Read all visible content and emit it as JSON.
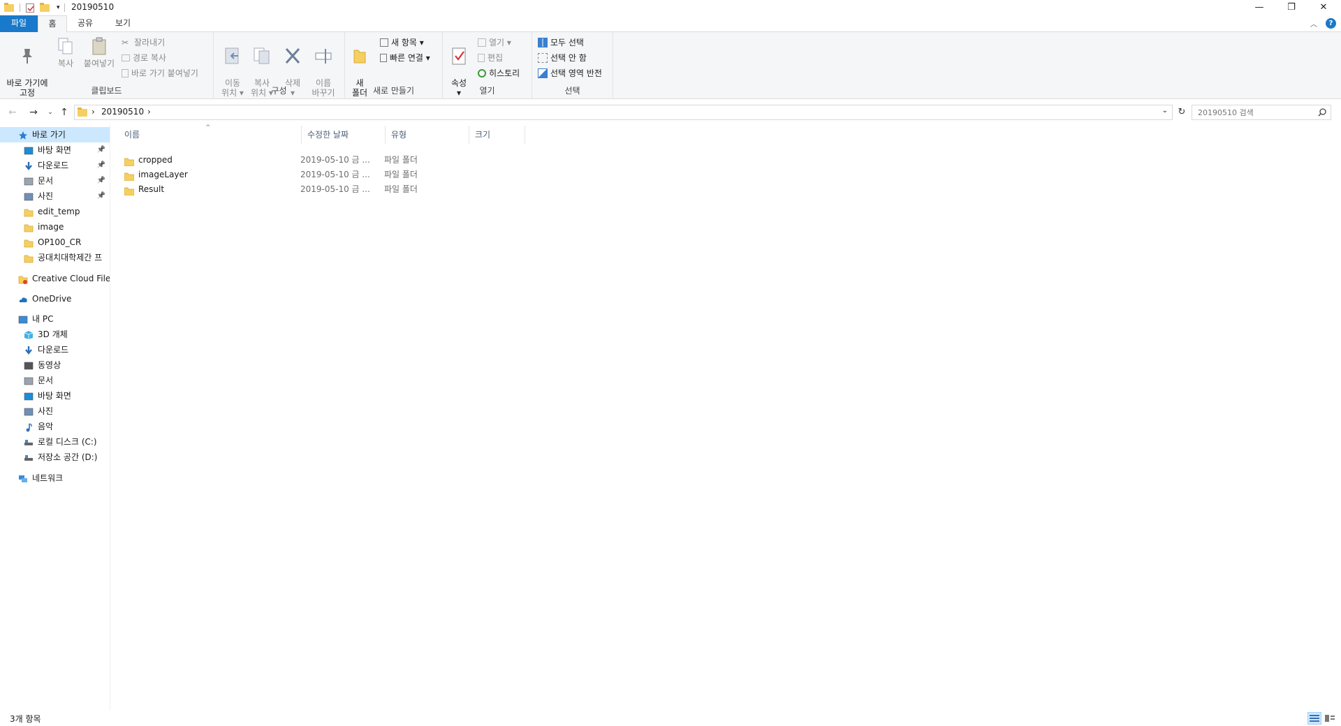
{
  "window": {
    "title": "20190510",
    "controls": {
      "minimize": "—",
      "restore": "❐",
      "close": "✕"
    }
  },
  "tabs": [
    {
      "label": "파일"
    },
    {
      "label": "홈"
    },
    {
      "label": "공유"
    },
    {
      "label": "보기"
    }
  ],
  "ribbon": {
    "clipboard": {
      "label": "클립보드",
      "pin": "바로 가기에\n고정",
      "copy": "복사",
      "paste": "붙여넣기",
      "cut": "잘라내기",
      "copy_path": "경로 복사",
      "paste_shortcut": "바로 가기 붙여넣기"
    },
    "organize": {
      "label": "구성",
      "move_to": "이동\n위치 ▾",
      "copy_to": "복사\n위치 ▾",
      "delete": "삭제\n▾",
      "rename": "이름\n바꾸기"
    },
    "new": {
      "label": "새로 만들기",
      "new_folder": "새\n폴더",
      "new_item": "새 항목 ▾",
      "easy_access": "빠른 연결 ▾"
    },
    "open": {
      "label": "열기",
      "properties": "속성\n▾",
      "open": "열기 ▾",
      "edit": "편집",
      "history": "히스토리"
    },
    "select": {
      "label": "선택",
      "select_all": "모두 선택",
      "select_none": "선택 안 함",
      "invert": "선택 영역 반전"
    }
  },
  "address": {
    "path": [
      "20190510"
    ],
    "sep": "›",
    "search_placeholder": "20190510 검색"
  },
  "nav": [
    {
      "label": "바로 가기",
      "icon": "star-icon",
      "pinned": false
    },
    {
      "label": "바탕 화면",
      "icon": "desktop-icon",
      "pinned": true
    },
    {
      "label": "다운로드",
      "icon": "download-icon",
      "pinned": true
    },
    {
      "label": "문서",
      "icon": "document-icon",
      "pinned": true
    },
    {
      "label": "사진",
      "icon": "picture-icon",
      "pinned": true
    },
    {
      "label": "edit_temp",
      "icon": "folder-icon",
      "pinned": false
    },
    {
      "label": "image",
      "icon": "folder-icon",
      "pinned": false
    },
    {
      "label": "OP100_CR",
      "icon": "folder-icon",
      "pinned": false
    },
    {
      "label": "공대치대학제간 프",
      "icon": "folder-icon",
      "pinned": false
    },
    {
      "label": "Creative Cloud Files",
      "icon": "creative-cloud-icon",
      "pinned": false
    },
    {
      "label": "OneDrive",
      "icon": "onedrive-icon",
      "pinned": false
    },
    {
      "label": "내 PC",
      "icon": "pc-icon",
      "pinned": false
    },
    {
      "label": "3D 개체",
      "icon": "cube-icon",
      "pinned": false
    },
    {
      "label": "다운로드",
      "icon": "download-icon",
      "pinned": false
    },
    {
      "label": "동영상",
      "icon": "video-icon",
      "pinned": false
    },
    {
      "label": "문서",
      "icon": "document-icon",
      "pinned": false
    },
    {
      "label": "바탕 화면",
      "icon": "desktop-icon",
      "pinned": false
    },
    {
      "label": "사진",
      "icon": "picture-icon",
      "pinned": false
    },
    {
      "label": "음악",
      "icon": "music-icon",
      "pinned": false
    },
    {
      "label": "로컬 디스크 (C:)",
      "icon": "drive-icon",
      "pinned": false
    },
    {
      "label": "저장소 공간 (D:)",
      "icon": "drive-icon",
      "pinned": false
    },
    {
      "label": "네트워크",
      "icon": "network-icon",
      "pinned": false
    }
  ],
  "columns": {
    "name": "이름",
    "modified": "수정한 날짜",
    "type": "유형",
    "size": "크기"
  },
  "files": [
    {
      "name": "cropped",
      "modified": "2019-05-10 금 ...",
      "type": "파일 폴더"
    },
    {
      "name": "imageLayer",
      "modified": "2019-05-10 금 ...",
      "type": "파일 폴더"
    },
    {
      "name": "Result",
      "modified": "2019-05-10 금 ...",
      "type": "파일 폴더"
    }
  ],
  "status": {
    "count": "3개 항목"
  },
  "colors": {
    "accent": "#1979ca",
    "selection": "#cce8ff",
    "folder": "#f5cf60"
  }
}
